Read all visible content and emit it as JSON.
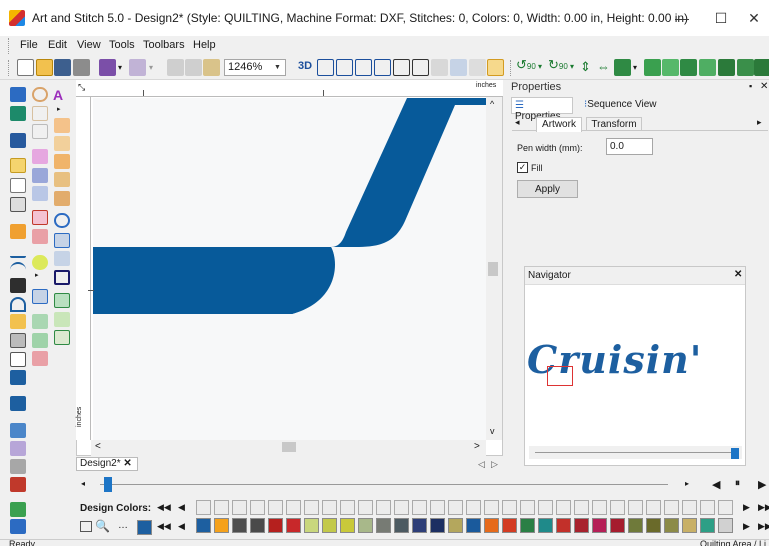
{
  "window": {
    "title": "Art and Stitch 5.0 - Design2* (Style: QUILTING, Machine Format: DXF, Stitches: 0, Colors: 0, Width: 0.00 in, Height: 0.00 in)",
    "minimize": "—",
    "maximize": "☐",
    "close": "✕"
  },
  "menu": [
    "File",
    "Edit",
    "View",
    "Tools",
    "Toolbars",
    "Help"
  ],
  "toolbar": {
    "zoom": "1246%",
    "btn_3d": "3D",
    "rot_90a": "90",
    "rot_90b": "90"
  },
  "ruler": {
    "unit_top": "inches",
    "unit_left": "inches"
  },
  "document_tab": {
    "label": "Design2*",
    "close": "✕"
  },
  "properties": {
    "title": "Properties",
    "pin": "📌",
    "close": "✕",
    "tab_properties": "Properties",
    "tab_sequence": "Sequence View",
    "sub_artwork": "Artwork",
    "sub_transform": "Transform",
    "pen_label": "Pen width (mm):",
    "pen_value": "0.0",
    "fill_label": "Fill",
    "fill_checked": true,
    "apply": "Apply"
  },
  "navigator": {
    "title": "Navigator",
    "close": "✕",
    "preview_text": "Cruisin'"
  },
  "colors": {
    "label": "Design Colors:",
    "palette": [
      "#1d5fa0",
      "#f5a11b",
      "#4e4e4e",
      "#4a4a4a",
      "#b5201e",
      "#c8282a",
      "#c9d77d",
      "#c3c94a",
      "#c9c93a",
      "#a8b88a",
      "#777b74",
      "#4c5a62",
      "#2d3e78",
      "#1c2f62",
      "#b4a75d",
      "#1a5a9c",
      "#e66a1b",
      "#d33b22",
      "#2a7f45",
      "#1f8a8a",
      "#c2302a",
      "#a8222e",
      "#b51f57",
      "#a51c2e",
      "#6f7a3a",
      "#6a6a2a",
      "#8c8b47",
      "#c8b066",
      "#2d9f86",
      "#d1d1d1"
    ]
  },
  "status": {
    "left": "Ready",
    "right": "Quilting Area / Li"
  }
}
